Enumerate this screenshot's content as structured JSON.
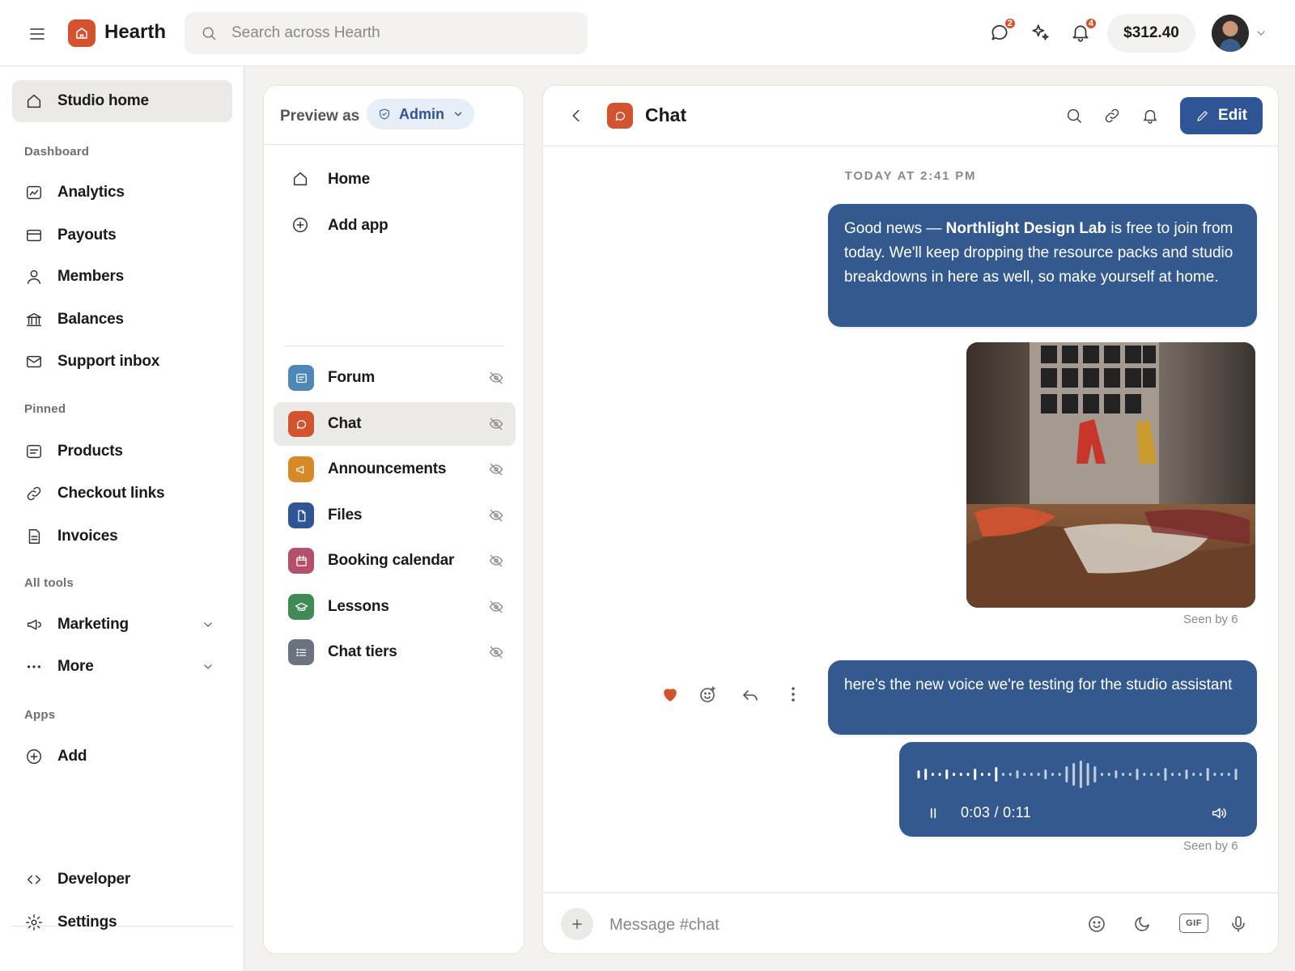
{
  "app": {
    "name": "Hearth"
  },
  "topbar": {
    "search_placeholder": "Search across Hearth",
    "messages_badge": "2",
    "notifications_badge": "4",
    "balance": "$312.40"
  },
  "leftnav": {
    "studio_home": "Studio home",
    "sections": {
      "dashboard": "Dashboard",
      "pinned": "Pinned",
      "all_tools": "All tools",
      "apps": "Apps"
    },
    "dashboard_items": [
      "Analytics",
      "Payouts",
      "Members",
      "Balances",
      "Support inbox"
    ],
    "pinned_items": [
      "Products",
      "Checkout links",
      "Invoices"
    ],
    "tools_items": [
      "Marketing",
      "More"
    ],
    "apps_items": [
      "Add"
    ],
    "bottom_items": [
      "Developer",
      "Settings"
    ]
  },
  "middle": {
    "preview_label": "Preview as",
    "role": "Admin",
    "top_items": [
      "Home",
      "Add app"
    ],
    "apps": [
      {
        "label": "Forum",
        "color": "#4f87b8",
        "icon": "forum-icon"
      },
      {
        "label": "Chat",
        "color": "#d4532f",
        "icon": "chat-icon"
      },
      {
        "label": "Announcements",
        "color": "#d68a26",
        "icon": "megaphone-icon"
      },
      {
        "label": "Files",
        "color": "#2f5597",
        "icon": "file-icon"
      },
      {
        "label": "Booking calendar",
        "color": "#b4506b",
        "icon": "calendar-icon"
      },
      {
        "label": "Lessons",
        "color": "#3f8a55",
        "icon": "graduation-icon"
      },
      {
        "label": "Chat tiers",
        "color": "#6b7280",
        "icon": "list-icon"
      }
    ]
  },
  "chat": {
    "title": "Chat",
    "edit_label": "Edit",
    "timestamp": "TODAY AT 2:41 PM",
    "message1": {
      "prefix": "Good news — ",
      "bold": "Northlight Design Lab",
      "suffix": " is free to join from today. We'll keep dropping the resource packs and studio breakdowns in here as well, so make yourself at home."
    },
    "seen1": "Seen by 6",
    "message2": "here's the new voice we're testing for the studio assistant",
    "voice": {
      "time": "0:03 / 0:11",
      "progress": 0.27
    },
    "seen2": "Seen by 6",
    "composer_placeholder": "Message #chat",
    "gif_label": "GIF"
  },
  "colors": {
    "accent": "#d4532f",
    "primary": "#2f5597",
    "bubble": "#34598e"
  }
}
